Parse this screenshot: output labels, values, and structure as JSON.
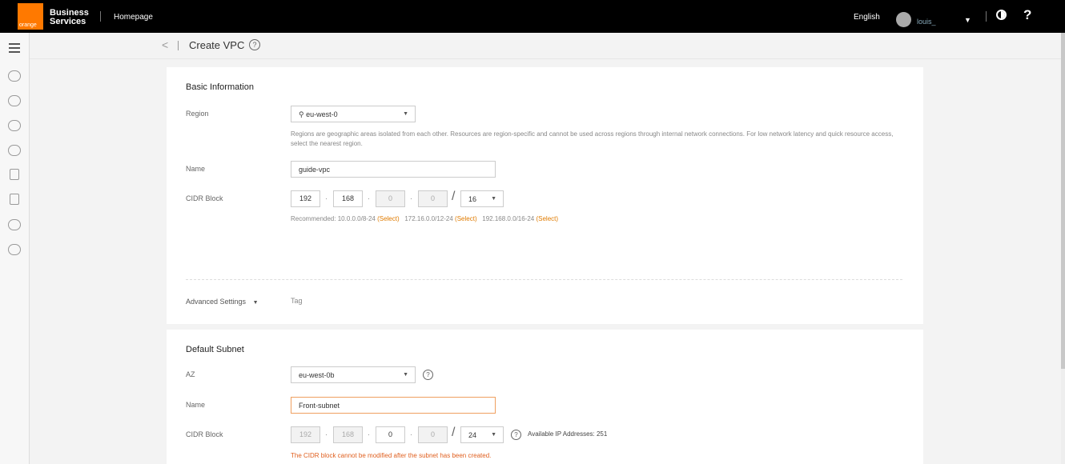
{
  "topbar": {
    "logo_text": "orange",
    "brand_line1": "Business",
    "brand_line2": "Services",
    "homepage": "Homepage",
    "language": "English",
    "username": "louis_"
  },
  "page": {
    "title": "Create VPC",
    "help": "?"
  },
  "basic": {
    "section_title": "Basic Information",
    "region_label": "Region",
    "region_value": "eu-west-0",
    "region_hint": "Regions are geographic areas isolated from each other. Resources are region-specific and cannot be used across regions through internal network connections. For low network latency and quick resource access, select the nearest region.",
    "name_label": "Name",
    "name_value": "guide-vpc",
    "cidr_label": "CIDR Block",
    "cidr_octets": [
      "192",
      "168",
      "0",
      "0"
    ],
    "cidr_mask": "16",
    "recommended_prefix": "Recommended: 10.0.0.0/8-24",
    "recommended_2": "172.16.0.0/12-24",
    "recommended_3": "192.168.0.0/16-24",
    "select_link": "(Select)",
    "advanced_label": "Advanced Settings",
    "tag_label": "Tag"
  },
  "subnet": {
    "section_title": "Default Subnet",
    "az_label": "AZ",
    "az_value": "eu-west-0b",
    "name_label": "Name",
    "name_value": "Front-subnet",
    "cidr_label": "CIDR Block",
    "cidr_octets": [
      "192",
      "168",
      "0",
      "0"
    ],
    "cidr_mask": "24",
    "available_ips": "Available IP Addresses: 251",
    "cidr_error": "The CIDR block cannot be modified after the subnet has been created."
  }
}
